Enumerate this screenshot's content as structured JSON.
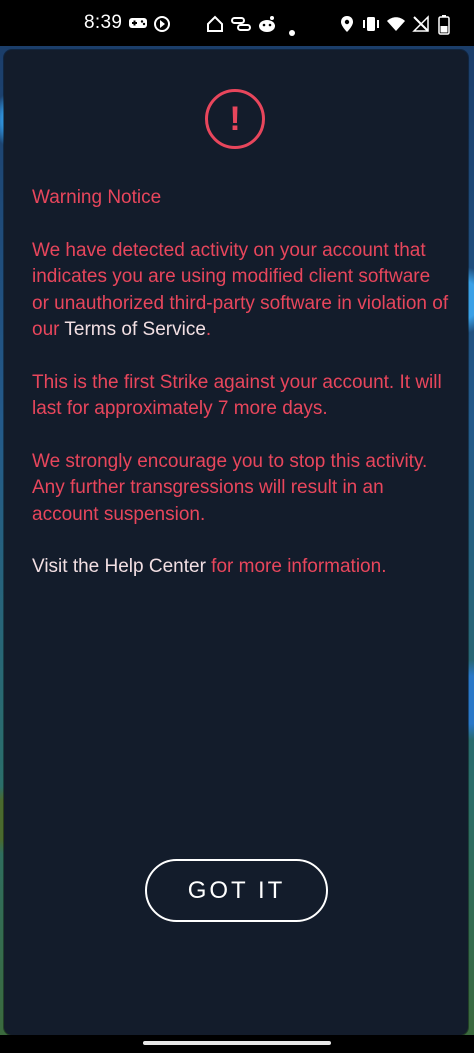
{
  "status_bar": {
    "time": "8:39",
    "left_icons": [
      "gamepad-icon",
      "sync-icon"
    ],
    "center_icons": [
      "home-icon",
      "link-icon",
      "reddit-icon",
      "dot-icon"
    ],
    "right_icons": [
      "location-icon",
      "vibrate-icon",
      "wifi-icon",
      "no-signal-icon",
      "battery-icon"
    ]
  },
  "dialog": {
    "icon": "alert-icon",
    "icon_glyph": "!",
    "title": "Warning Notice",
    "paragraph1_prefix": "We have detected activity on your account that indicates you are using modified client software or unauthorized third-party software in violation of our ",
    "terms_link": "Terms of Service",
    "paragraph1_suffix": ".",
    "paragraph2": "This is the first Strike against your account. It will last for approximately 7 more days.",
    "paragraph3": "We strongly encourage you to stop this activity. Any further transgressions will result in an account suspension.",
    "help_link": "Visit the Help Center",
    "help_suffix": " for more information.",
    "button_label": "GOT IT"
  },
  "colors": {
    "accent": "#e8465c",
    "dialog_bg": "#131c2b",
    "button_border": "#ffffff"
  }
}
